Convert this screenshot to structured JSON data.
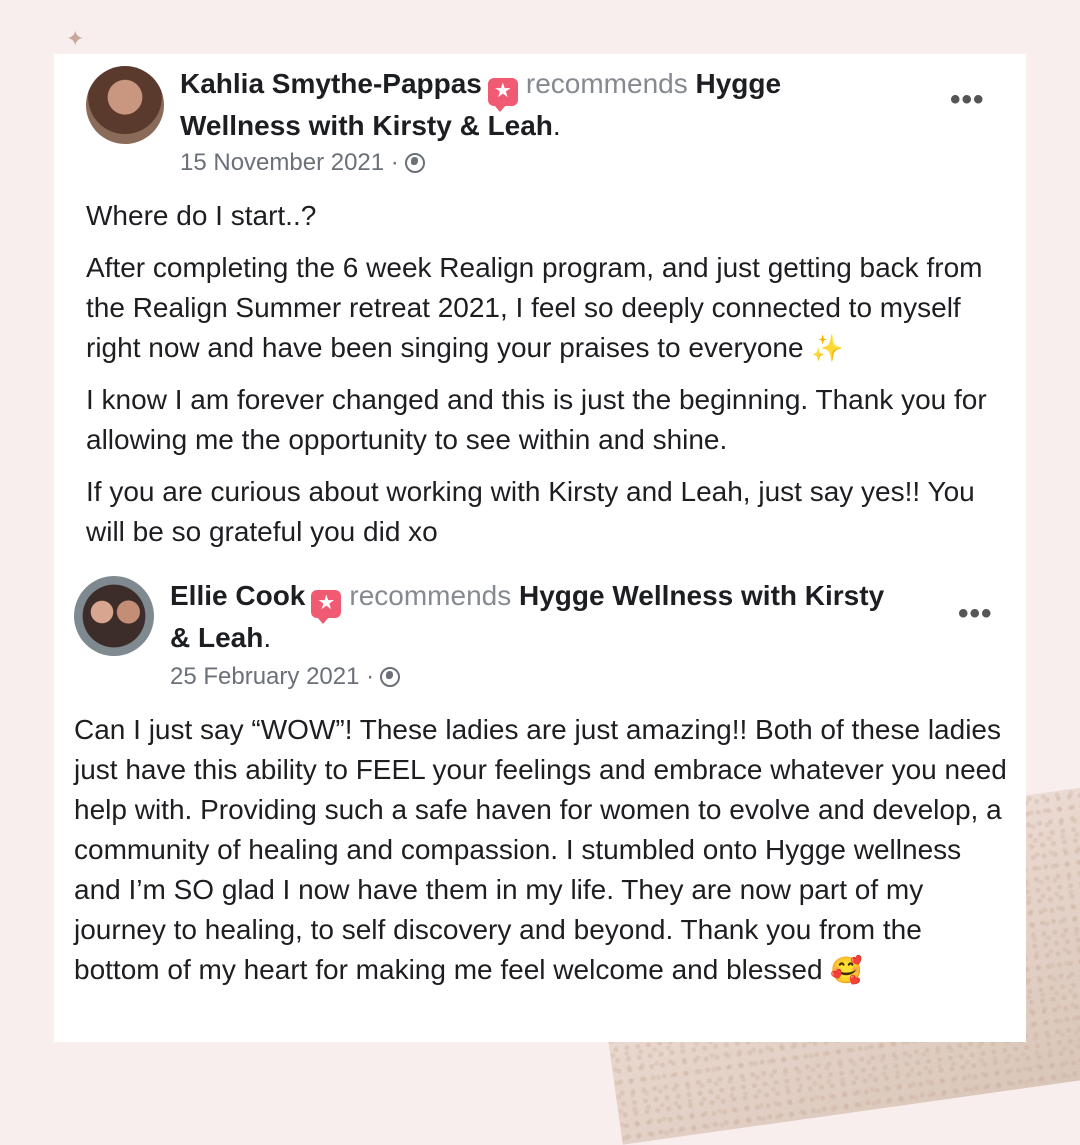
{
  "reviews": [
    {
      "author": "Kahlia Smythe-Pappas",
      "badge_icon": "star-badge-icon",
      "action": "recommends",
      "page_name": "Hygge Wellness with Kirsty & Leah",
      "date": "15 November 2021 ·",
      "paragraphs": [
        "Where do I start..?",
        "After completing the 6 week Realign program, and just getting back from the Realign Summer retreat 2021, I feel so deeply connected to myself right now and have been singing your praises to everyone",
        "I know I am forever changed and this is just the beginning. Thank you for allowing me the opportunity to see within and shine.",
        "If you are curious about working with Kirsty and Leah, just say yes!! You will be so grateful you did xo"
      ],
      "emoji": "✨"
    },
    {
      "author": "Ellie Cook",
      "badge_icon": "star-badge-icon",
      "action": "recommends",
      "page_name": "Hygge Wellness with Kirsty & Leah",
      "date": "25 February 2021 ·",
      "paragraphs": [
        "Can I just say “WOW”! These ladies are just amazing!! Both of these ladies just have this ability to FEEL your feelings and embrace whatever you need help with. Providing such a safe haven for women to evolve and develop, a community of healing and compassion. I stumbled onto Hygge wellness and I’m SO glad I now have them in my life. They are now part of my journey to healing, to self discovery and beyond. Thank you from the bottom of my heart for making me feel welcome and blessed"
      ],
      "emoji": "🥰"
    }
  ],
  "more_label": "•••",
  "badge_glyph": "★",
  "colors": {
    "badge": "#f05a72",
    "meta": "#6b7079",
    "background": "#f9eeee"
  }
}
